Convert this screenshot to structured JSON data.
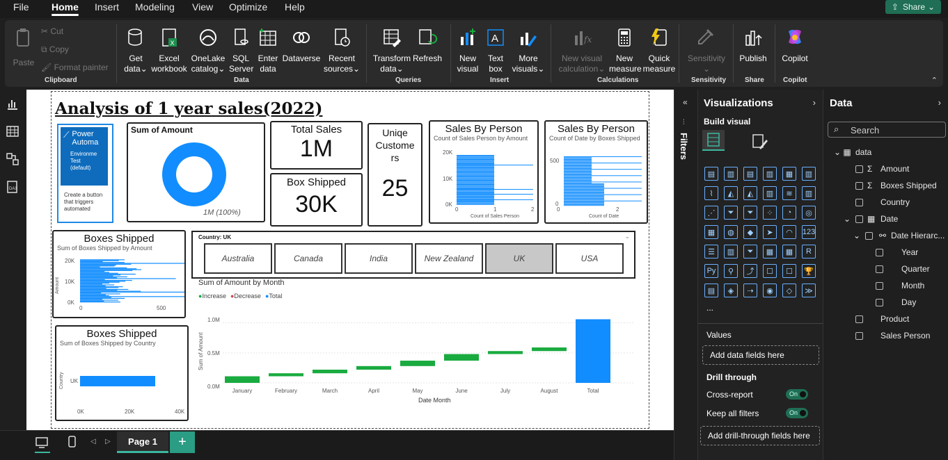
{
  "menu": {
    "file": "File",
    "home": "Home",
    "insert": "Insert",
    "modeling": "Modeling",
    "view": "View",
    "optimize": "Optimize",
    "help": "Help",
    "share": "Share"
  },
  "ribbon": {
    "paste": "Paste",
    "cut": "Cut",
    "copy": "Copy",
    "format_painter": "Format painter",
    "clipboard": "Clipboard",
    "get_data": [
      "Get",
      "data"
    ],
    "excel": [
      "Excel",
      "workbook"
    ],
    "onelake": [
      "OneLake",
      "catalog"
    ],
    "sql": [
      "SQL",
      "Server"
    ],
    "enter_data": [
      "Enter",
      "data"
    ],
    "dataverse": "Dataverse",
    "recent": [
      "Recent",
      "sources"
    ],
    "data_group": "Data",
    "transform": [
      "Transform",
      "data"
    ],
    "refresh": "Refresh",
    "queries": "Queries",
    "new_visual": [
      "New",
      "visual"
    ],
    "text_box": [
      "Text",
      "box"
    ],
    "more_visuals": [
      "More",
      "visuals"
    ],
    "insert_group": "Insert",
    "new_visual_calc": [
      "New visual",
      "calculation"
    ],
    "new_measure": [
      "New",
      "measure"
    ],
    "quick_measure": [
      "Quick",
      "measure"
    ],
    "calculations": "Calculations",
    "sensitivity": "Sensitivity",
    "sensitivity_group": "Sensitivity",
    "publish": "Publish",
    "share_group": "Share",
    "copilot": "Copilot",
    "copilot_group": "Copilot"
  },
  "report": {
    "title": "Analysis of 1 year  sales(2022) ",
    "power_automate": {
      "title_1": "Power",
      "title_2": "Automa",
      "env_1": "Environme",
      "env_2": "Test",
      "env_3": "(default)",
      "desc": "Create a button that triggers automated"
    },
    "sum_amount": {
      "title": "Sum of Amount",
      "label": "1M (100%)"
    },
    "total_sales": {
      "title": "Total Sales",
      "value": "1M"
    },
    "box_shipped_card": {
      "title": "Box Shipped",
      "value": "30K"
    },
    "unique_customers": {
      "title_1": "Uniqe",
      "title_2": "Custome",
      "title_3": "rs",
      "value": "25"
    },
    "sales_by_person_1": {
      "title": "Sales By Person",
      "sub": "Count of Sales Person by Amount",
      "y_ticks": [
        "20K",
        "10K",
        "0K"
      ],
      "x_ticks": [
        "0",
        "1",
        "2"
      ],
      "x_label": "Count of Sales Person"
    },
    "sales_by_person_2": {
      "title": "Sales By Person",
      "sub": "Count of Date by Boxes Shipped",
      "y_ticks": [
        "500",
        "0"
      ],
      "x_ticks": [
        "0",
        "2"
      ],
      "x_label": "Count of Date"
    },
    "boxes_shipped_1": {
      "title": "Boxes Shipped",
      "sub": "Sum of Boxes Shipped by Amount",
      "y_ticks": [
        "20K",
        "10K",
        "0K"
      ],
      "x_ticks": [
        "0",
        "500"
      ],
      "y_label": "Amount"
    },
    "boxes_shipped_2": {
      "title": "Boxes Shipped",
      "sub": "Sum of Boxes Shipped by Country",
      "y_label": "Country",
      "category": "UK",
      "x_ticks": [
        "0K",
        "20K",
        "40K"
      ]
    },
    "slicer": {
      "header": "Country: UK",
      "options": [
        "Australia",
        "Canada",
        "India",
        "New Zealand",
        "UK",
        "USA"
      ],
      "selected": "UK"
    },
    "waterfall": {
      "title": "Sum of Amount by Month",
      "legend": [
        "Increase",
        "Decrease",
        "Total"
      ],
      "y_label": "Sum of Amount",
      "x_label": "Date Month",
      "y_ticks": [
        "1.0M",
        "0.5M",
        "0.0M"
      ]
    }
  },
  "chart_data": {
    "type": "bar",
    "title": "Sum of Amount by Month",
    "xlabel": "Date Month",
    "ylabel": "Sum of Amount",
    "categories": [
      "January",
      "February",
      "March",
      "April",
      "May",
      "June",
      "July",
      "August",
      "Total"
    ],
    "series": [
      {
        "name": "Increase",
        "values": [
          0.11,
          0.05,
          0.06,
          0.06,
          0.09,
          0.11,
          0.05,
          0.06,
          null
        ]
      },
      {
        "name": "Total",
        "values": [
          null,
          null,
          null,
          null,
          null,
          null,
          null,
          null,
          1.06
        ]
      }
    ],
    "ylim": [
      0,
      1.1
    ]
  },
  "filters_label": "Filters",
  "visualizations": {
    "title": "Visualizations",
    "build": "Build visual",
    "values": "Values",
    "add_fields": "Add data fields here",
    "drill": "Drill through",
    "cross_report": "Cross-report",
    "keep_filters": "Keep all filters",
    "toggle_on": "On",
    "add_drill": "Add drill-through fields here",
    "more": "..."
  },
  "data_pane": {
    "title": "Data",
    "search": "Search",
    "table": "data",
    "fields": [
      "Amount",
      "Boxes Shipped",
      "Country",
      "Date",
      "Date Hierarc...",
      "Year",
      "Quarter",
      "Month",
      "Day",
      "Product",
      "Sales Person"
    ]
  },
  "bottom": {
    "page": "Page 1",
    "add": "+"
  },
  "colors": {
    "accent": "#118dff",
    "increase": "#1aab40",
    "decrease": "#d64550",
    "brand": "#1f6e55"
  }
}
